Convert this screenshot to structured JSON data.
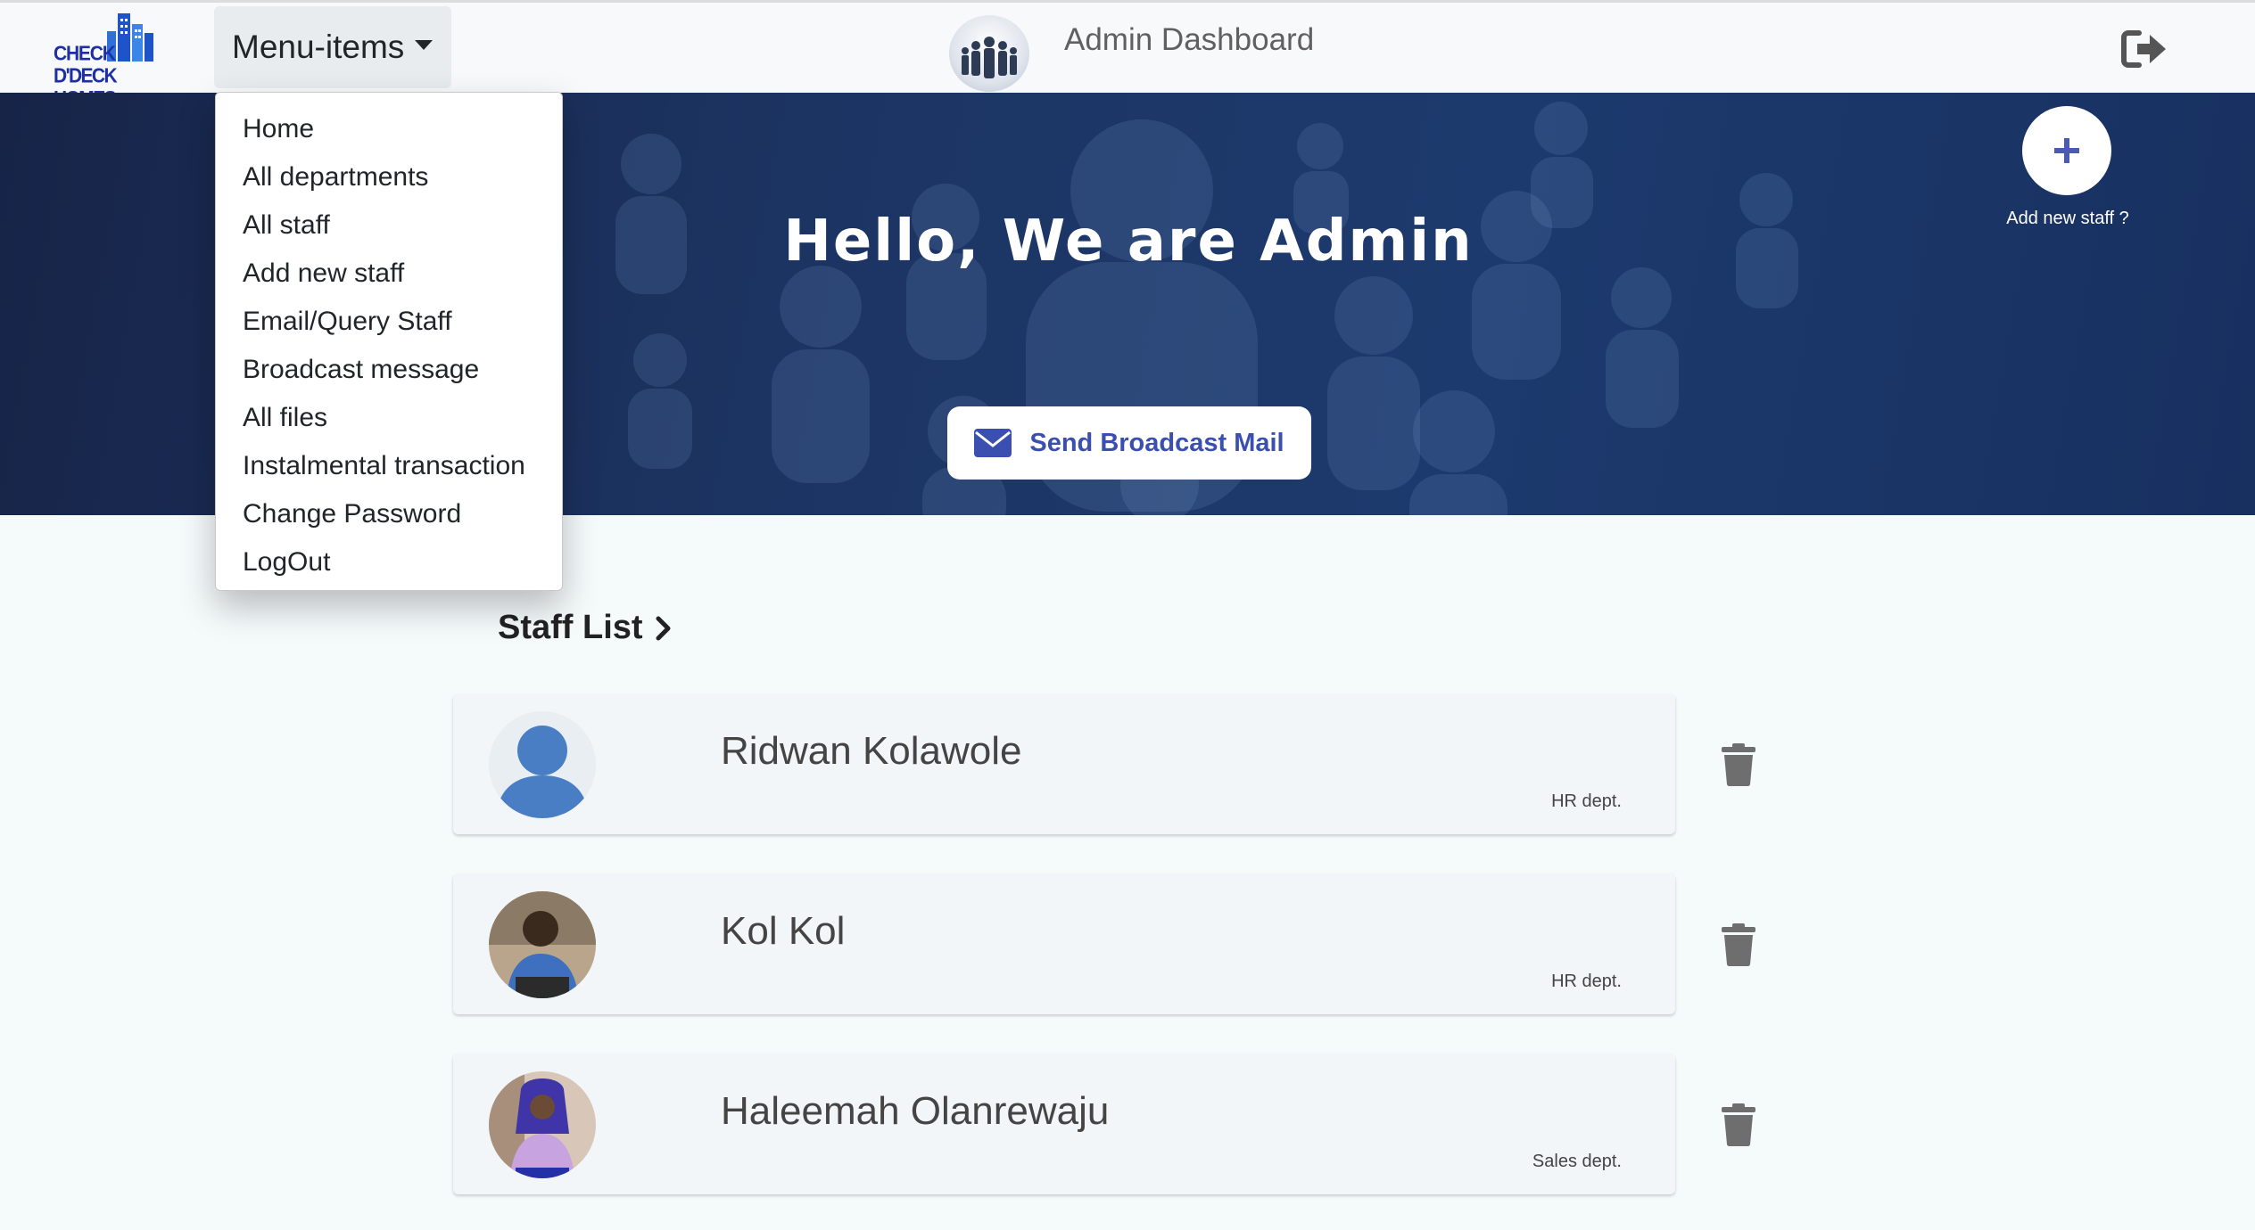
{
  "brand": {
    "line1": "CHECK",
    "line2": "D'DECK HOMES"
  },
  "nav": {
    "menu_label": "Menu-items",
    "title": "Admin Dashboard"
  },
  "menu": {
    "items": [
      "Home",
      "All departments",
      "All staff",
      "Add new staff",
      "Email/Query Staff",
      "Broadcast message",
      "All files",
      "Instalmental transaction",
      "Change Password",
      "LogOut"
    ]
  },
  "hero": {
    "title": "Hello, We are Admin",
    "broadcast_label": "Send Broadcast Mail",
    "add_staff_label": "Add new staff ?"
  },
  "staff_list": {
    "heading": "Staff List",
    "staff": [
      {
        "name": "Ridwan Kolawole",
        "dept": "HR dept."
      },
      {
        "name": "Kol Kol",
        "dept": "HR dept."
      },
      {
        "name": "Haleemah Olanrewaju",
        "dept": "Sales dept."
      }
    ]
  },
  "colors": {
    "brand_blue": "#1e2fa3",
    "hero_dark": "#1c3462",
    "accent_button_text": "#3b4fb0",
    "trash_gray": "#6e6e6e"
  }
}
